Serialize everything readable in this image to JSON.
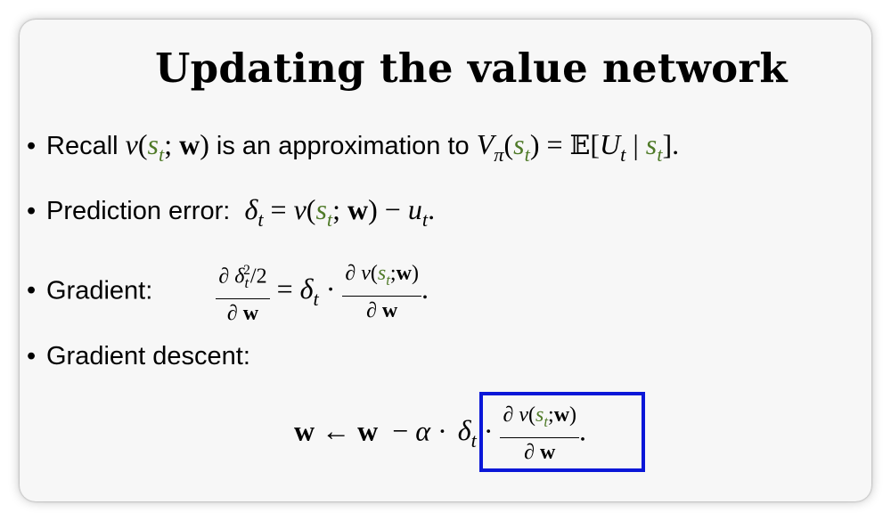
{
  "slide": {
    "title": "Updating the value network",
    "bullets": {
      "recall_label": "Recall",
      "recall_mid": "is an approximation to",
      "prediction_label": "Prediction error:",
      "gradient_label": "Gradient:",
      "descent_label": "Gradient descent:"
    }
  },
  "colors": {
    "state_green": "#4f7a28",
    "highlight_box": "#0a17d8"
  }
}
